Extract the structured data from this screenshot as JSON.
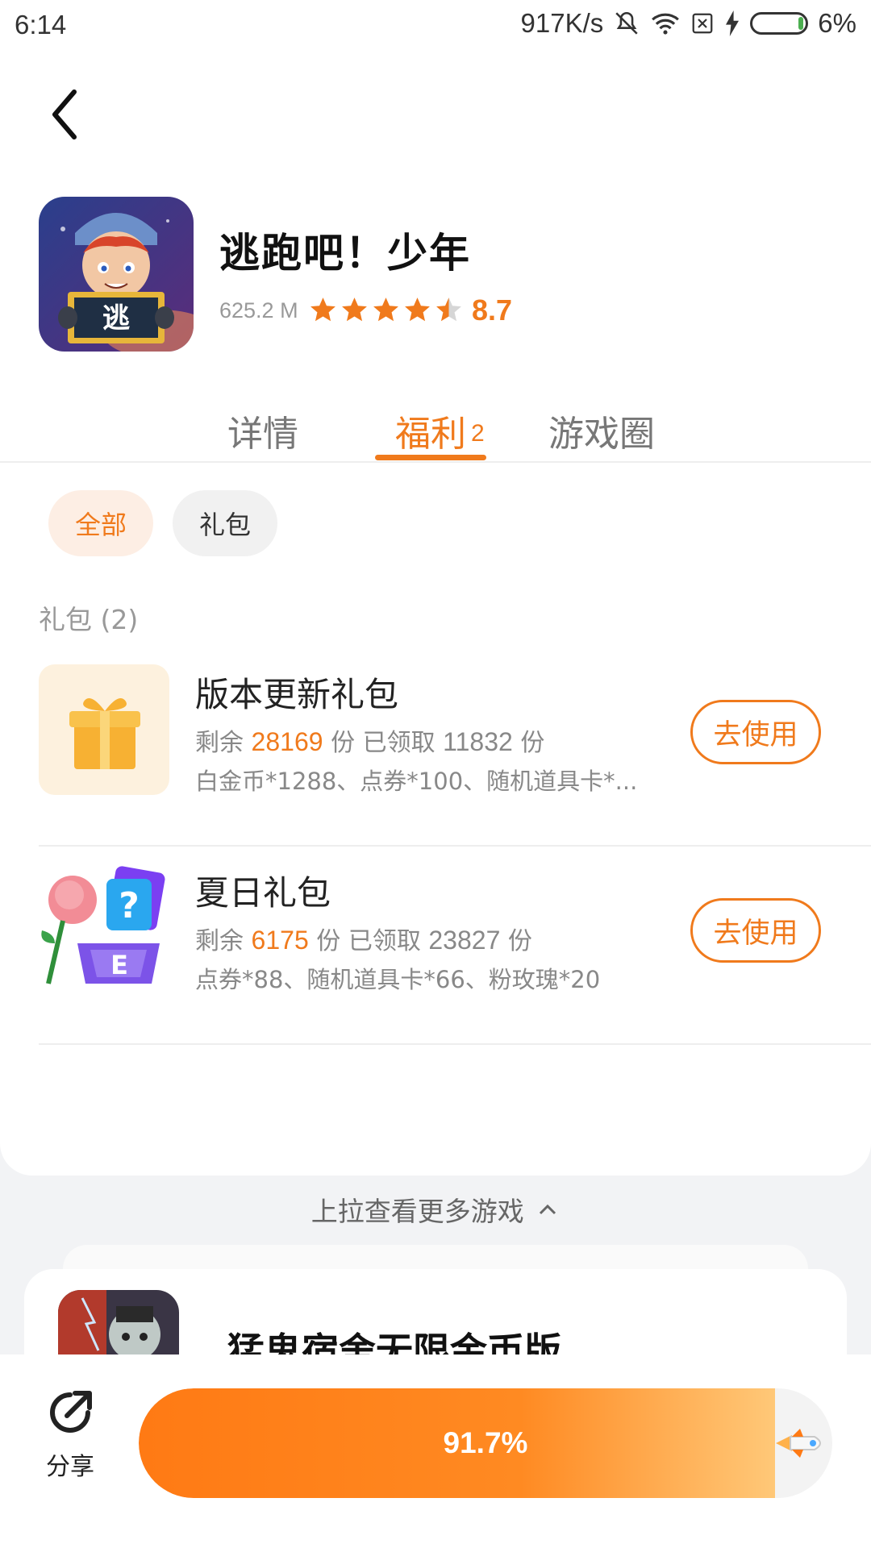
{
  "status_bar": {
    "time": "6:14",
    "net_speed": "917K/s",
    "battery": "6%",
    "icons": [
      "mute-icon",
      "wifi-icon",
      "sim-x-icon",
      "charging-icon",
      "battery-icon"
    ]
  },
  "app": {
    "title": "逃跑吧！少年",
    "size": "625.2 M",
    "rating": "8.7",
    "stars_filled": 4.5,
    "icon_char": "逃"
  },
  "tabs": [
    {
      "label": "详情"
    },
    {
      "label": "福利",
      "badge": "2"
    },
    {
      "label": "游戏圈"
    }
  ],
  "filters": {
    "all": "全部",
    "gift": "礼包"
  },
  "section_label": "礼包 (2)",
  "gifts": [
    {
      "name": "版本更新礼包",
      "remaining_label": "剩余",
      "remaining": "28169",
      "unit": "份",
      "claimed_label": "已领取",
      "claimed": "11832",
      "desc": "白金币*1288、点券*100、随机道具卡*...",
      "button": "去使用"
    },
    {
      "name": "夏日礼包",
      "remaining_label": "剩余",
      "remaining": "6175",
      "unit": "份",
      "claimed_label": "已领取",
      "claimed": "23827",
      "desc": "点券*88、随机道具卡*66、粉玫瑰*20",
      "button": "去使用"
    }
  ],
  "pull_up_text": "上拉查看更多游戏",
  "next_game": {
    "title": "猛鬼宿舍无限金币版"
  },
  "bottom": {
    "share_label": "分享",
    "progress_text": "91.7%",
    "progress_value": 0.917
  },
  "colors": {
    "accent": "#f07a1c",
    "chip_bg": "#fdeee4"
  }
}
